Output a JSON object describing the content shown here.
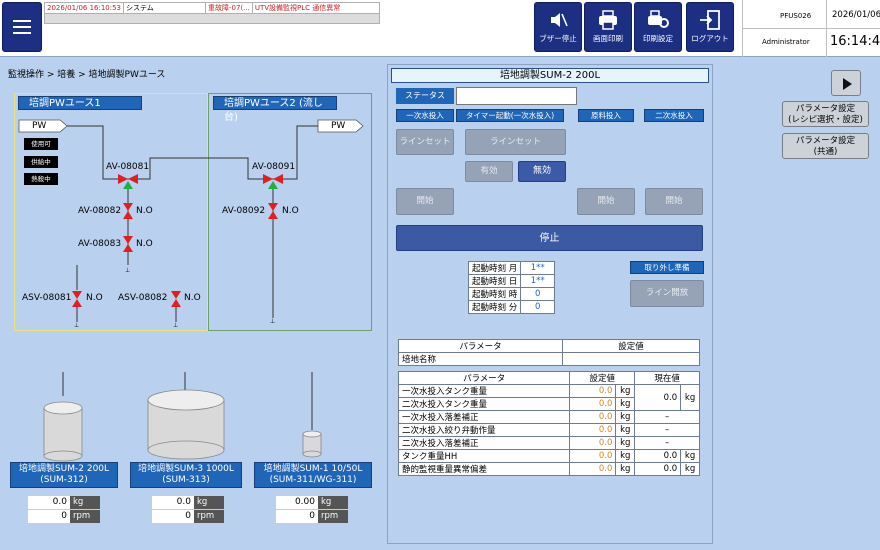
{
  "alarm": {
    "time": "2026/01/06 16:10:53",
    "system": "システム",
    "level": "重故障-07(...",
    "message": "UTV設備監視PLC 通信異常"
  },
  "toolbar": {
    "buzzer_stop": "ブザー停止",
    "screen_print": "画面印刷",
    "print_settings": "印刷設定",
    "logout": "ログアウト"
  },
  "header": {
    "terminal_id": "PFUS026",
    "date": "2026/01/06",
    "user": "Administrator",
    "clock": "16:14:49"
  },
  "breadcrumb": "監視操作 > 培養 > 培地調製PWユース",
  "area1": {
    "title": "培調PWユース1",
    "pw": "PW",
    "status_labels": [
      "使用可",
      "供給中",
      "熱殺中"
    ],
    "valves": {
      "av08081": "AV-08081",
      "av08082": "AV-08082",
      "av08083": "AV-08083",
      "asv08081": "ASV-08081",
      "asv08082": "ASV-08082",
      "no": "N.O"
    }
  },
  "area2": {
    "title": "培調PWユース2 (流し台)",
    "pw": "PW",
    "valves": {
      "av08091": "AV-08091",
      "av08092": "AV-08092",
      "no": "N.O"
    }
  },
  "tanks": [
    {
      "name": "培地調製SUM-2 200L",
      "code": "(SUM-312)",
      "kg": "0.0",
      "rpm": "0",
      "unit_kg": "kg",
      "unit_rpm": "rpm"
    },
    {
      "name": "培地調製SUM-3 1000L",
      "code": "(SUM-313)",
      "kg": "0.0",
      "rpm": "0",
      "unit_kg": "kg",
      "unit_rpm": "rpm"
    },
    {
      "name": "培地調製SUM-1 10/50L",
      "code": "(SUM-311/WG-311)",
      "kg": "0.00",
      "rpm": "0",
      "unit_kg": "kg",
      "unit_rpm": "rpm"
    }
  ],
  "panel": {
    "title": "培地調製SUM-2 200L",
    "status_key": "ステータス",
    "status_value": "",
    "tags": [
      "一次水投入",
      "タイマー起動(一次水投入)",
      "原料投入",
      "二次水投入"
    ],
    "line_set_1": "ラインセット",
    "line_set_2": "ラインセット",
    "enable": "有効",
    "disable": "無効",
    "start_1": "開始",
    "start_2": "開始",
    "start_3": "開始",
    "stop": "停止",
    "remove_prep": "取り外し準備",
    "line_open": "ライン開放",
    "start_time": [
      {
        "label": "起動時刻 月",
        "value": "1**"
      },
      {
        "label": "起動時刻 日",
        "value": "1**"
      },
      {
        "label": "起動時刻 時",
        "value": "0"
      },
      {
        "label": "起動時刻 分",
        "value": "0"
      }
    ],
    "param1": {
      "h_param": "パラメータ",
      "h_set": "設定値",
      "row_label": "培地名称",
      "row_value": ""
    },
    "param2": {
      "h_param": "パラメータ",
      "h_set": "設定値",
      "h_current": "現在値",
      "rows": [
        {
          "label": "一次水投入タンク重量",
          "set": "0.0",
          "unit": "kg"
        },
        {
          "label": "二次水投入タンク重量",
          "set": "0.0",
          "unit": "kg"
        },
        {
          "label": "一次水投入落差補正",
          "set": "0.0",
          "unit": "kg",
          "cur": "–"
        },
        {
          "label": "二次水投入絞り弁動作量",
          "set": "0.0",
          "unit": "kg",
          "cur": "–"
        },
        {
          "label": "二次水投入落差補正",
          "set": "0.0",
          "unit": "kg",
          "cur": "–"
        },
        {
          "label": "タンク重量HH",
          "set": "0.0",
          "unit": "kg",
          "cur": "0.0",
          "cur_unit": "kg"
        },
        {
          "label": "静的監視重量異常偏差",
          "set": "0.0",
          "unit": "kg",
          "cur": "0.0",
          "cur_unit": "kg"
        }
      ],
      "merged_current": "0.0",
      "merged_unit": "kg"
    }
  },
  "side": {
    "param_recipe": [
      "パラメータ設定",
      "(レシピ選択・設定)"
    ],
    "param_common": [
      "パラメータ設定",
      "(共通)"
    ]
  },
  "colors": {
    "valve_closed": "#e02020",
    "valve_open": "#20b040",
    "accent": "#2066b8",
    "navy": "#1c2f83"
  }
}
